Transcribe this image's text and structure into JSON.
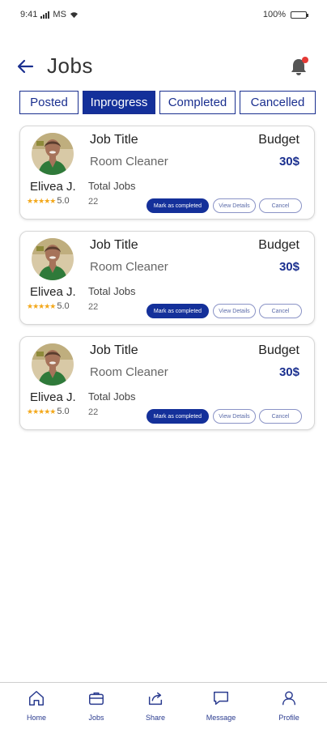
{
  "status_bar": {
    "time": "9:41",
    "carrier": "MS",
    "battery": "100%"
  },
  "header": {
    "title": "Jobs"
  },
  "tabs": [
    {
      "label": "Posted",
      "active": false
    },
    {
      "label": "Inprogress",
      "active": true
    },
    {
      "label": "Completed",
      "active": false
    },
    {
      "label": "Cancelled",
      "active": false
    }
  ],
  "jobs": [
    {
      "worker_name": "Elivea J.",
      "rating": "5.0",
      "job_title_label": "Job Title",
      "job_title": "Room Cleaner",
      "budget_label": "Budget",
      "budget": "30$",
      "total_jobs_label": "Total Jobs",
      "total_jobs": "22",
      "complete_label": "Mark as completed",
      "details_label": "View Details",
      "cancel_label": "Cancel"
    },
    {
      "worker_name": "Elivea J.",
      "rating": "5.0",
      "job_title_label": "Job Title",
      "job_title": "Room Cleaner",
      "budget_label": "Budget",
      "budget": "30$",
      "total_jobs_label": "Total Jobs",
      "total_jobs": "22",
      "complete_label": "Mark as completed",
      "details_label": "View Details",
      "cancel_label": "Cancel"
    },
    {
      "worker_name": "Elivea J.",
      "rating": "5.0",
      "job_title_label": "Job Title",
      "job_title": "Room Cleaner",
      "budget_label": "Budget",
      "budget": "30$",
      "total_jobs_label": "Total Jobs",
      "total_jobs": "22",
      "complete_label": "Mark as completed",
      "details_label": "View Details",
      "cancel_label": "Cancel"
    }
  ],
  "bottom_nav": [
    {
      "label": "Home",
      "icon": "home-icon"
    },
    {
      "label": "Jobs",
      "icon": "briefcase-icon"
    },
    {
      "label": "Share",
      "icon": "share-icon"
    },
    {
      "label": "Message",
      "icon": "chat-icon"
    },
    {
      "label": "Profile",
      "icon": "person-icon"
    }
  ],
  "colors": {
    "primary": "#14309a",
    "accent_star": "#f3a81b",
    "notification_dot": "#e53935"
  }
}
